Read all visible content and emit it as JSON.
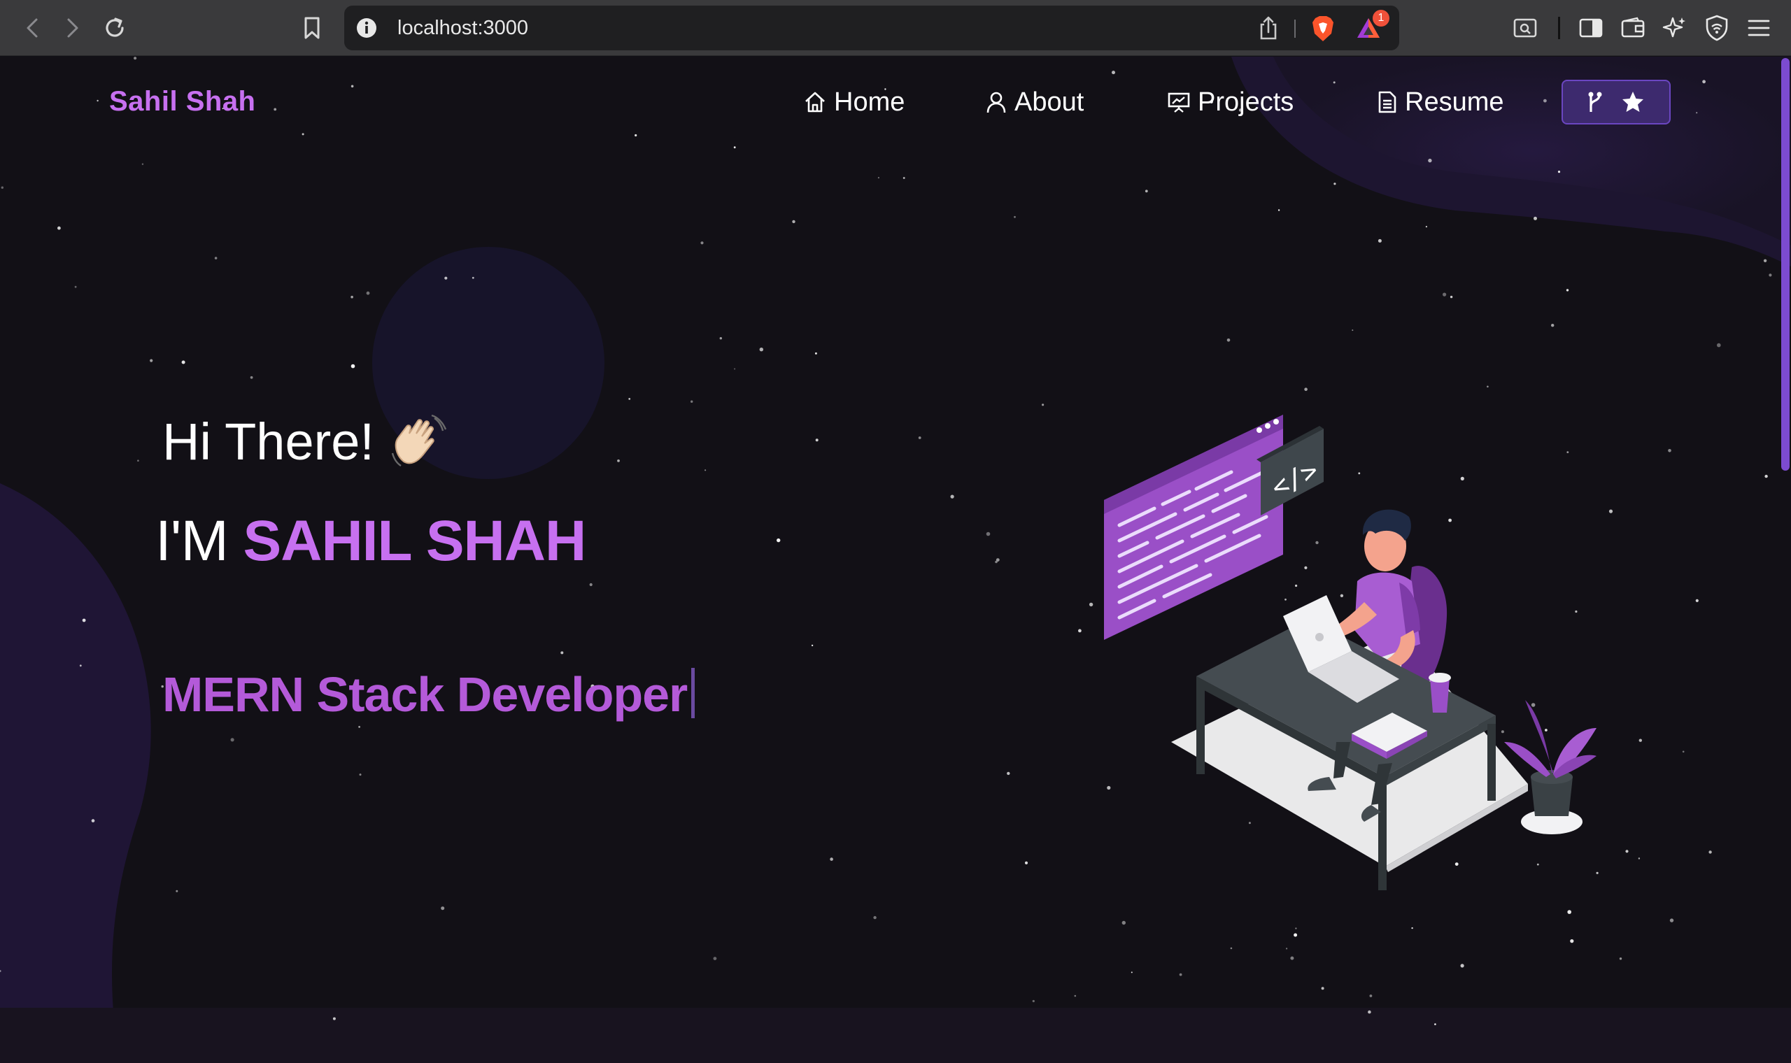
{
  "browser": {
    "url": "localhost:3000",
    "notification_count": "1",
    "accent": "#fb542b"
  },
  "nav": {
    "brand": "Sahil Shah",
    "items": [
      {
        "label": "Home",
        "icon": "home-icon"
      },
      {
        "label": "About",
        "icon": "user-icon"
      },
      {
        "label": "Projects",
        "icon": "presentation-icon"
      },
      {
        "label": "Resume",
        "icon": "document-icon"
      }
    ],
    "fork_icons": [
      "git-fork-icon",
      "star-icon"
    ]
  },
  "hero": {
    "greeting": "Hi There!",
    "greeting_emoji": "wave-icon",
    "intro_prefix": "I'M",
    "name": "SAHIL SHAH",
    "role": "MERN Stack Developer",
    "illustration_code_tag": "</>"
  },
  "colors": {
    "accent": "#c770f0",
    "background": "#121016",
    "button_bg": "#3d2a6e"
  }
}
